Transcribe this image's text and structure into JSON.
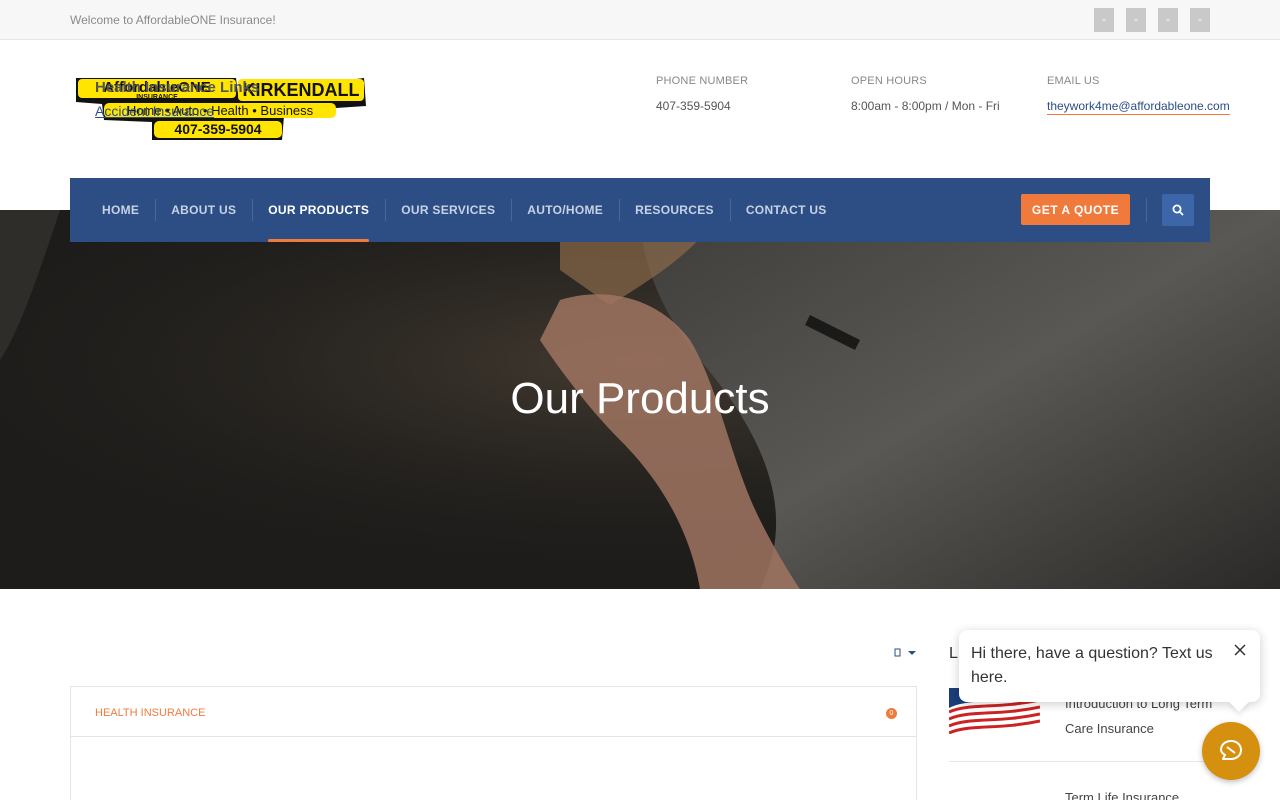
{
  "topbar": {
    "welcome": "Welcome to AffordableONE Insurance!",
    "social_icons": [
      "facebook-icon",
      "twitter-icon",
      "linkedin-icon",
      "youtube-icon"
    ]
  },
  "header": {
    "logo": {
      "brand": "AffordableONE",
      "sub": "INSURANCE",
      "agent": "KIRKENDALL",
      "lines": "Home • Auto • Health • Business",
      "phone": "407-359-5904"
    },
    "contact": [
      {
        "label": "PHONE NUMBER",
        "value": "407-359-5904"
      },
      {
        "label": "OPEN HOURS",
        "value": "8:00am - 8:00pm / Mon - Fri"
      },
      {
        "label": "EMAIL US",
        "value": "theywork4me@affordableone.com"
      }
    ]
  },
  "nav": {
    "items": [
      "HOME",
      "ABOUT US",
      "OUR PRODUCTS",
      "OUR SERVICES",
      "AUTO/HOME",
      "RESOURCES",
      "CONTACT US"
    ],
    "active": "OUR PRODUCTS",
    "quote_label": "GET A QUOTE"
  },
  "hero": {
    "title": "Our Products"
  },
  "accordion": {
    "title": "HEALTH INSURANCE",
    "count": "0",
    "body_heading": "Health Insurance Links",
    "body_link": "Accident Insurance"
  },
  "sidebar": {
    "heading_partial": "L",
    "posts": [
      {
        "title": "Introduction to Long Term Care Insurance"
      },
      {
        "title": "Term Life Insurance"
      }
    ]
  },
  "chat": {
    "message": "Hi there, have a question? Text us here."
  },
  "colors": {
    "nav_bg": "#2d4e84",
    "accent": "#f07a3c",
    "chat_button": "#d4900e",
    "logo_yellow": "#ffe500"
  }
}
